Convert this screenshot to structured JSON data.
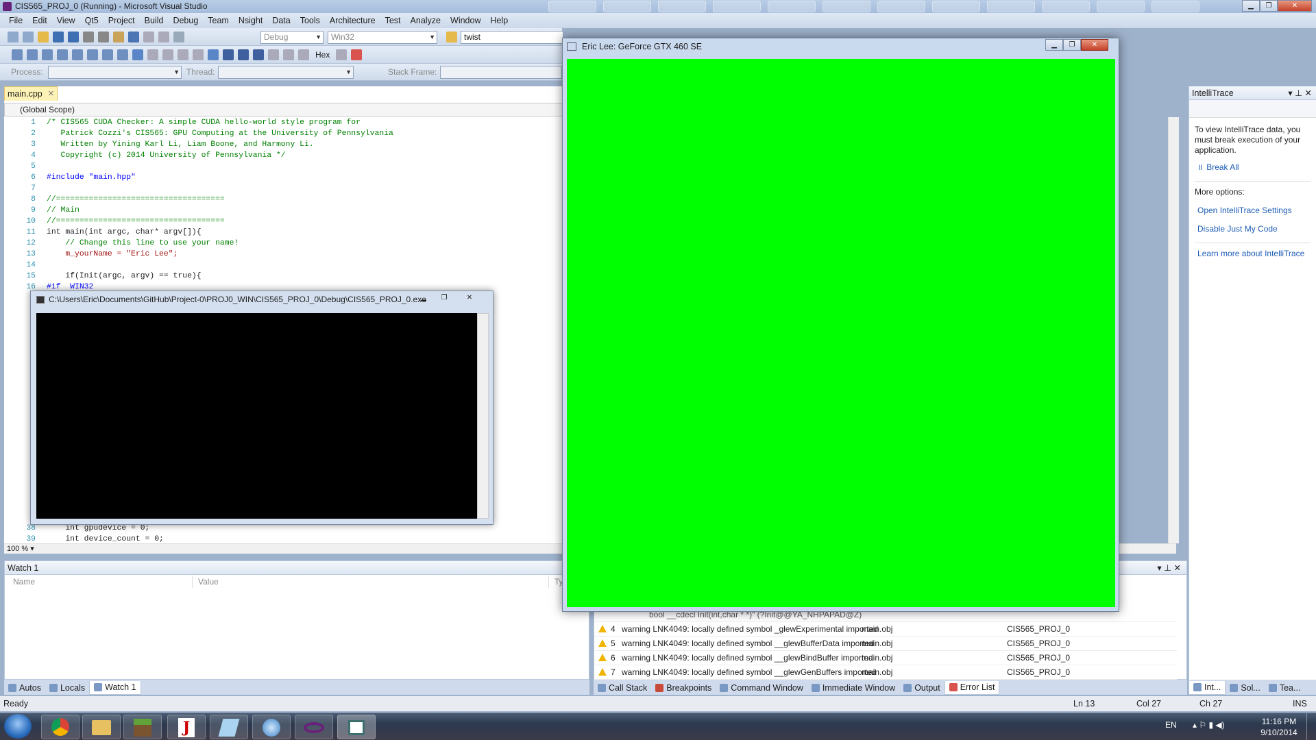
{
  "window": {
    "title": "CIS565_PROJ_0 (Running) - Microsoft Visual Studio"
  },
  "menu": [
    "File",
    "Edit",
    "View",
    "Qt5",
    "Project",
    "Build",
    "Debug",
    "Team",
    "Nsight",
    "Data",
    "Tools",
    "Architecture",
    "Test",
    "Analyze",
    "Window",
    "Help"
  ],
  "toolbar": {
    "config": "Debug",
    "platform": "Win32",
    "find": "twist",
    "hex_label": "Hex",
    "process_label": "Process:",
    "thread_label": "Thread:",
    "stackframe_label": "Stack Frame:"
  },
  "editor": {
    "tab": "main.cpp",
    "scope": "(Global Scope)",
    "zoom": "100 %",
    "lines": [
      {
        "n": "1",
        "t": "/* CIS565 CUDA Checker: A simple CUDA hello-world style program for"
      },
      {
        "n": "2",
        "t": "   Patrick Cozzi's CIS565: GPU Computing at the University of Pennsylvania"
      },
      {
        "n": "3",
        "t": "   Written by Yining Karl Li, Liam Boone, and Harmony Li."
      },
      {
        "n": "4",
        "t": "   Copyright (c) 2014 University of Pennsylvania */"
      },
      {
        "n": "5",
        "t": ""
      },
      {
        "n": "6",
        "t": "#include \"main.hpp\""
      },
      {
        "n": "7",
        "t": ""
      },
      {
        "n": "8",
        "t": "//===================================="
      },
      {
        "n": "9",
        "t": "// Main"
      },
      {
        "n": "10",
        "t": "//===================================="
      },
      {
        "n": "11",
        "t": "int main(int argc, char* argv[]){"
      },
      {
        "n": "12",
        "t": "    // Change this line to use your name!"
      },
      {
        "n": "13",
        "t": "    m_yourName = \"Eric Lee\";"
      },
      {
        "n": "14",
        "t": ""
      },
      {
        "n": "15",
        "t": "    if(Init(argc, argv) == true){"
      },
      {
        "n": "16",
        "t": "#if  WIN32"
      }
    ],
    "tail_lines": [
      {
        "n": "38",
        "t": "    int gpudevice = 0;"
      },
      {
        "n": "39",
        "t": "    int device_count = 0;"
      }
    ]
  },
  "watch": {
    "title": "Watch 1",
    "columns": [
      "Name",
      "Value",
      "Typ"
    ],
    "tabs": [
      "Autos",
      "Locals",
      "Watch 1"
    ]
  },
  "errors": {
    "partial_row": "bool __cdecl Init(int,char * *)\" (?Init@@YA_NHPAPAD@Z)",
    "rows": [
      {
        "n": "4",
        "desc": "warning LNK4049: locally defined symbol _glewExperimental imported",
        "file": "main.obj",
        "project": "CIS565_PROJ_0"
      },
      {
        "n": "5",
        "desc": "warning LNK4049: locally defined symbol __glewBufferData imported",
        "file": "main.obj",
        "project": "CIS565_PROJ_0"
      },
      {
        "n": "6",
        "desc": "warning LNK4049: locally defined symbol __glewBindBuffer imported",
        "file": "main.obj",
        "project": "CIS565_PROJ_0"
      },
      {
        "n": "7",
        "desc": "warning LNK4049: locally defined symbol __glewGenBuffers imported",
        "file": "main.obj",
        "project": "CIS565_PROJ_0"
      }
    ],
    "tabs": [
      "Call Stack",
      "Breakpoints",
      "Command Window",
      "Immediate Window",
      "Output",
      "Error List"
    ]
  },
  "intellitrace": {
    "title": "IntelliTrace",
    "message": "To view IntelliTrace data, you must break execution of your application.",
    "break_all": "Break All",
    "more_options": "More options:",
    "links": [
      "Open IntelliTrace Settings",
      "Disable Just My Code"
    ],
    "learn_more": "Learn more about IntelliTrace",
    "tabs": [
      "Int...",
      "Sol...",
      "Tea..."
    ]
  },
  "console": {
    "title": "C:\\Users\\Eric\\Documents\\GitHub\\Project-0\\PROJ0_WIN\\CIS565_PROJ_0\\Debug\\CIS565_PROJ_0.exe"
  },
  "glwindow": {
    "title": "Eric Lee: GeForce GTX 460 SE",
    "fill_color": "#00ff00"
  },
  "status": {
    "ready": "Ready",
    "ln": "Ln 13",
    "col": "Col 27",
    "ch": "Ch 27",
    "ins": "INS"
  },
  "tray": {
    "lang": "EN",
    "time": "11:16 PM",
    "date": "9/10/2014"
  },
  "taskbar_apps": [
    "chrome-icon",
    "explorer-icon",
    "minecraft-icon",
    "jgrasp-icon",
    "notepad-icon",
    "itunes-icon",
    "visual-studio-icon",
    "app-window-icon"
  ]
}
